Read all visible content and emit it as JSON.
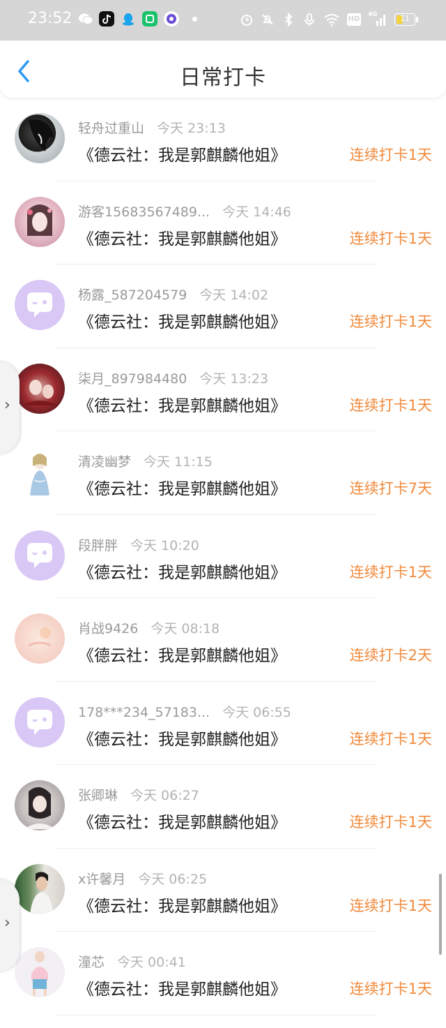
{
  "status_bar": {
    "time": "23:52",
    "network_label": "4G",
    "hd_label": "HD",
    "battery": "11"
  },
  "header": {
    "title": "日常打卡"
  },
  "rows": [
    {
      "name": "轻舟过重山",
      "time": "今天 23:13",
      "book": "《德云社：我是郭麒麟他姐》",
      "streak": "连续打卡1天"
    },
    {
      "name": "游客15683567489...",
      "time": "今天 14:46",
      "book": "《德云社：我是郭麒麟他姐》",
      "streak": "连续打卡1天"
    },
    {
      "name": "杨露_587204579",
      "time": "今天 14:02",
      "book": "《德云社：我是郭麒麟他姐》",
      "streak": "连续打卡1天"
    },
    {
      "name": "柒月_897984480",
      "time": "今天 13:23",
      "book": "《德云社：我是郭麒麟他姐》",
      "streak": "连续打卡1天"
    },
    {
      "name": "清凌幽梦",
      "time": "今天 11:15",
      "book": "《德云社：我是郭麒麟他姐》",
      "streak": "连续打卡7天"
    },
    {
      "name": "段胖胖",
      "time": "今天 10:20",
      "book": "《德云社：我是郭麒麟他姐》",
      "streak": "连续打卡1天"
    },
    {
      "name": "肖战9426",
      "time": "今天 08:18",
      "book": "《德云社：我是郭麒麟他姐》",
      "streak": "连续打卡2天"
    },
    {
      "name": "178***234_57183...",
      "time": "今天 06:55",
      "book": "《德云社：我是郭麒麟他姐》",
      "streak": "连续打卡1天"
    },
    {
      "name": "张卿琳",
      "time": "今天 06:27",
      "book": "《德云社：我是郭麒麟他姐》",
      "streak": "连续打卡1天"
    },
    {
      "name": "x许馨月",
      "time": "今天 06:25",
      "book": "《德云社：我是郭麒麟他姐》",
      "streak": "连续打卡1天"
    },
    {
      "name": "潼芯",
      "time": "今天 00:41",
      "book": "《德云社：我是郭麒麟他姐》",
      "streak": "连续打卡1天"
    }
  ],
  "colors": {
    "accent": "#2b9af3",
    "streak": "#f08a3c",
    "default_avatar": "#d9c8f5"
  }
}
